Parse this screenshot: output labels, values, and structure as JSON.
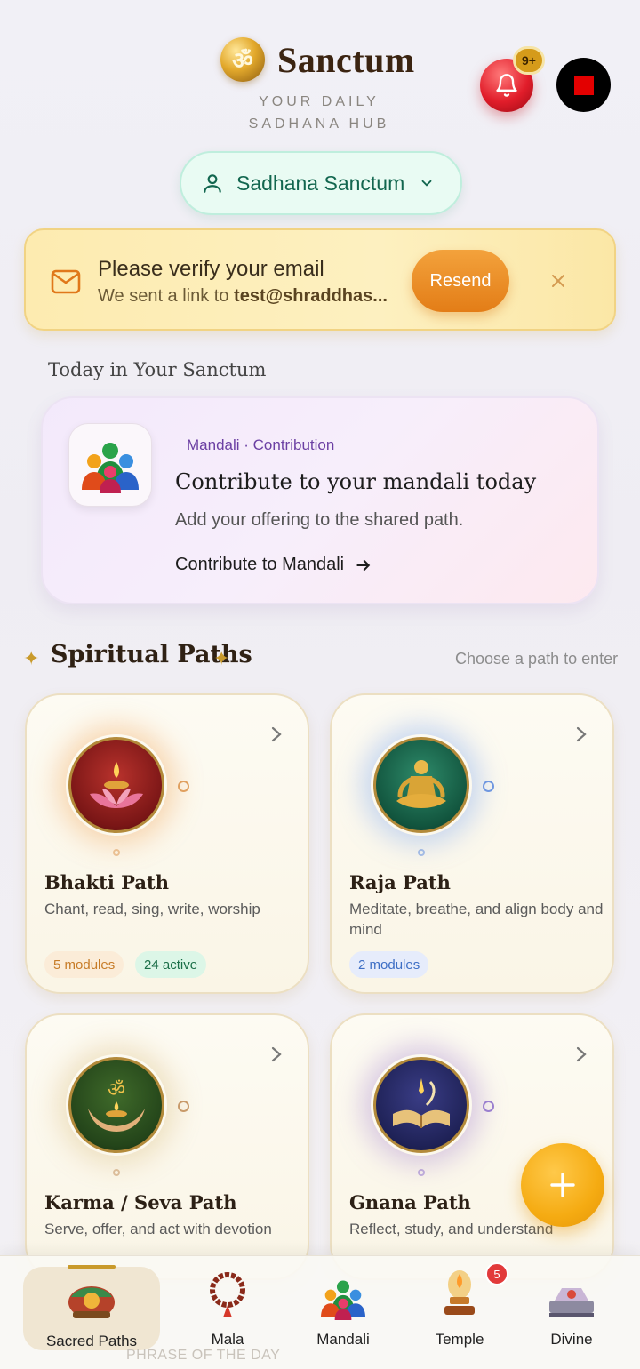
{
  "header": {
    "om_glyph": "ॐ",
    "app_title": "Sanctum",
    "tagline_line1": "YOUR DAILY",
    "tagline_line2": "SADHANA HUB",
    "notification_count": "9+"
  },
  "selector": {
    "label": "Sadhana Sanctum"
  },
  "verify_banner": {
    "title": "Please verify your email",
    "subtitle_prefix": "We sent a link to ",
    "email": "test@shraddhas...",
    "resend_label": "Resend"
  },
  "today": {
    "heading": "Today in Your Sanctum",
    "tag": "Mandali · Contribution",
    "title": "Contribute to your mandali today",
    "description": "Add your offering to the shared path.",
    "link": "Contribute to Mandali"
  },
  "paths_section": {
    "title": "Spiritual Paths",
    "subtitle": "Choose a path to enter",
    "cards": [
      {
        "title": "Bhakti Path",
        "description": "Chant, read, sing, write, worship",
        "chips": [
          "5 modules",
          "24 active"
        ]
      },
      {
        "title": "Raja Path",
        "description": "Meditate, breathe, and align body and mind",
        "chips": [
          "2 modules"
        ]
      },
      {
        "title": "Karma / Seva Path",
        "description": "Serve, offer, and act with devotion",
        "chips": []
      },
      {
        "title": "Gnana Path",
        "description": "Reflect, study, and understand",
        "chips": []
      }
    ]
  },
  "bottom_nav": {
    "items": [
      {
        "label": "Sacred Paths",
        "active": true
      },
      {
        "label": "Mala"
      },
      {
        "label": "Mandali"
      },
      {
        "label": "Temple",
        "badge": "5"
      },
      {
        "label": "Divine"
      }
    ]
  },
  "footer_peek": "PHRASE OF THE DAY",
  "colors": {
    "accent_gold": "#c99a2b",
    "selector_green": "#12664f",
    "resend_orange": "#e37d17",
    "fab_yellow": "#f5ab12",
    "bell_red": "#e11d2a"
  }
}
